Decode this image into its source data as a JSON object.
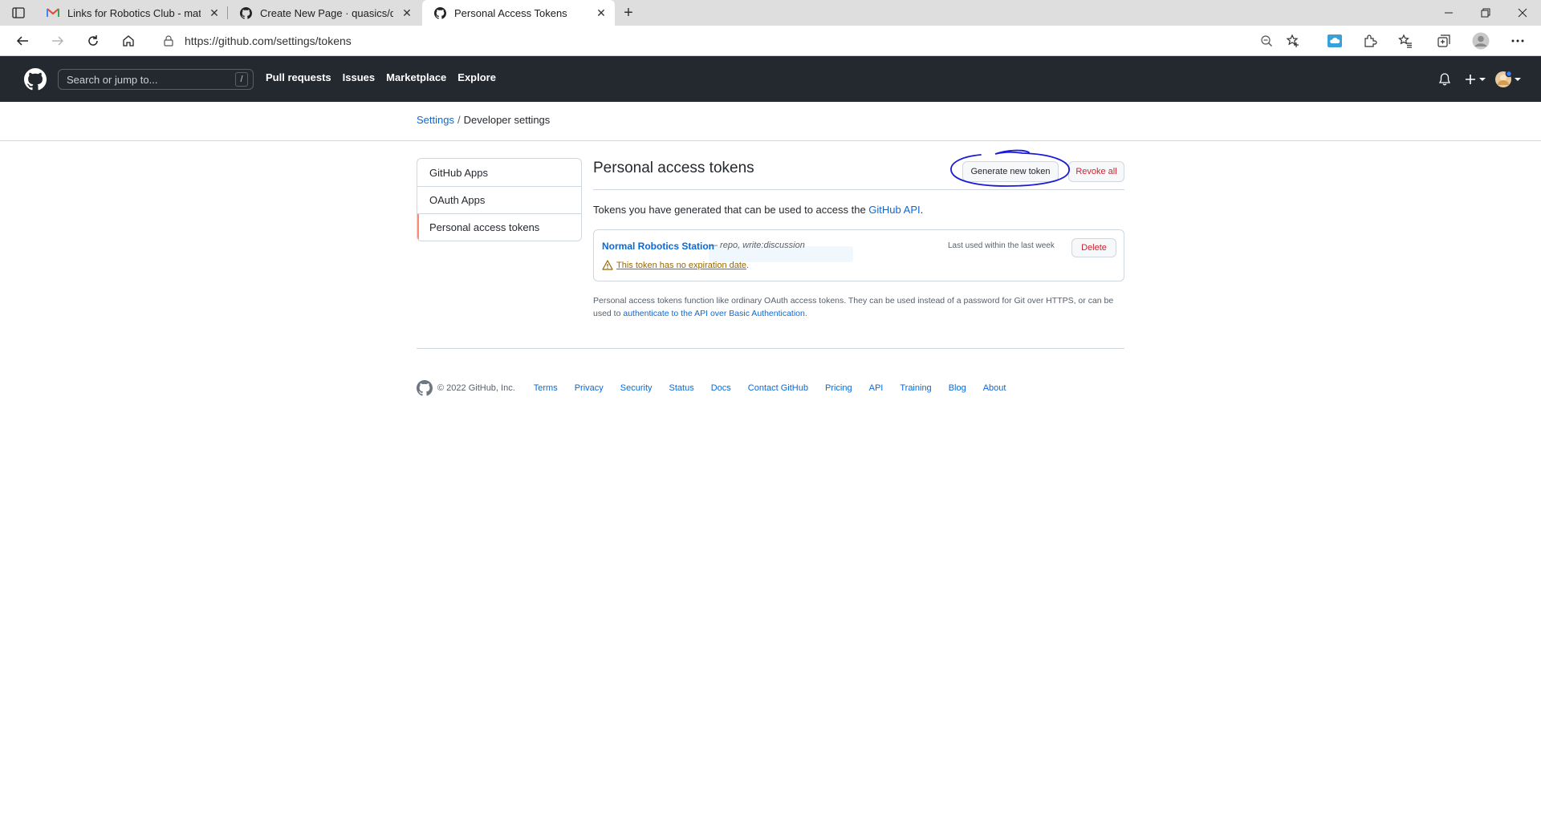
{
  "browser": {
    "tabs": [
      {
        "title": "Links for Robotics Club - mat.ba",
        "icon": "gmail-icon"
      },
      {
        "title": "Create New Page · quasics/quasi",
        "icon": "github-icon"
      },
      {
        "title": "Personal Access Tokens",
        "icon": "github-icon"
      }
    ],
    "url": "https://github.com/settings/tokens"
  },
  "header": {
    "search_placeholder": "Search or jump to...",
    "search_shortcut": "/",
    "nav": [
      "Pull requests",
      "Issues",
      "Marketplace",
      "Explore"
    ]
  },
  "breadcrumb": {
    "parent": "Settings",
    "separator": "/",
    "current": "Developer settings"
  },
  "sidebar": {
    "items": [
      {
        "label": "GitHub Apps"
      },
      {
        "label": "OAuth Apps"
      },
      {
        "label": "Personal access tokens"
      }
    ]
  },
  "main": {
    "title": "Personal access tokens",
    "generate_label": "Generate new token",
    "revoke_label": "Revoke all",
    "intro_text": "Tokens you have generated that can be used to access the ",
    "intro_link": "GitHub API",
    "intro_end": ".",
    "token": {
      "name": "Normal Robotics Station",
      "scopes": "— repo, write:discussion",
      "warning": "This token has no expiration date",
      "warning_end": ".",
      "last_used": "Last used within the last week",
      "delete_label": "Delete"
    },
    "note_text": "Personal access tokens function like ordinary OAuth access tokens. They can be used instead of a password for Git over HTTPS, or can be used to ",
    "note_link": "authenticate to the API over Basic Authentication",
    "note_end": "."
  },
  "footer": {
    "copyright": "© 2022 GitHub, Inc.",
    "links": [
      "Terms",
      "Privacy",
      "Security",
      "Status",
      "Docs",
      "Contact GitHub",
      "Pricing",
      "API",
      "Training",
      "Blog",
      "About"
    ]
  },
  "colors": {
    "header_bg": "#24292f",
    "link": "#0969da",
    "danger": "#cf222e",
    "warning": "#9a6700",
    "selected_accent": "#fd8c73",
    "annotation_circle": "#1a1adb"
  }
}
